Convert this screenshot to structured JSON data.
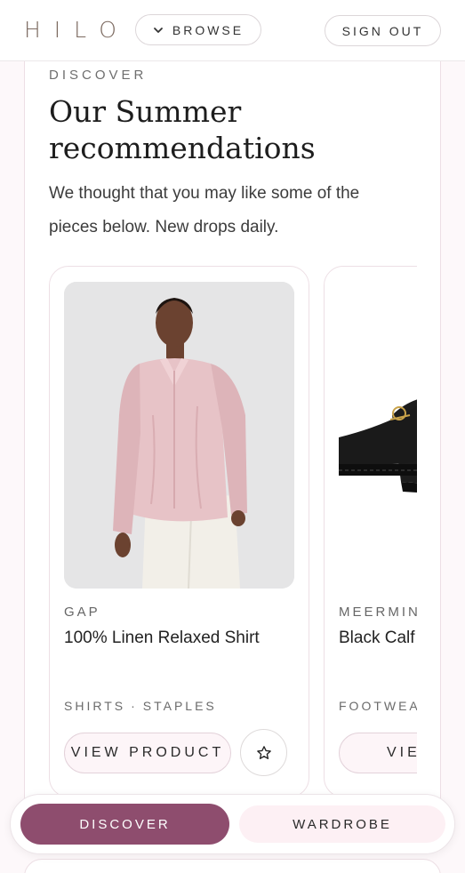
{
  "header": {
    "logo": "HILO",
    "browse_label": "BROWSE",
    "signout_label": "SIGN OUT"
  },
  "hero": {
    "eyebrow": "DISCOVER",
    "title": "Our Summer recommendations",
    "subtitle": "We thought that you may like some of the pieces below. New drops daily."
  },
  "products": [
    {
      "brand": "GAP",
      "name": "100% Linen Relaxed Shirt",
      "tags": [
        "SHIRTS",
        "STAPLES"
      ],
      "view_label": "VIEW PRODUCT",
      "image_icon": "model-pink-linen-shirt"
    },
    {
      "brand": "MEERMIN",
      "name": "Black Calf",
      "tags": [
        "FOOTWEAR"
      ],
      "view_label": "VIEW P",
      "image_icon": "black-loafer-shoe"
    }
  ],
  "tag_separator": "·",
  "bottom_nav": {
    "discover_label": "DISCOVER",
    "wardrobe_label": "WARDROBE"
  },
  "colors": {
    "accent": "#8e4d6e",
    "accent_light": "#fdf0f4",
    "logo": "#7c6a60"
  }
}
